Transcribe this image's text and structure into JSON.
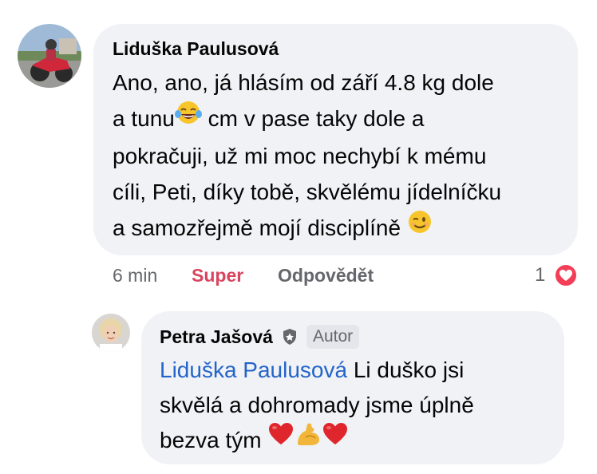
{
  "comment": {
    "author": "Liduška Paulusová",
    "lines": {
      "l1": "Ano, ano, já hlásím od září 4.8 kg dole",
      "l2a": "a tunu",
      "l2b": " cm v pase taky dole a",
      "l3": "pokračuji, už mi moc nechybí k mému",
      "l4": "cíli, Peti, díky tobě, skvělému jídelníčku",
      "l5": "a samozřejmě mojí disciplíně "
    },
    "time": "6 min",
    "reaction_label": "Super",
    "reply_label": "Odpovědět",
    "reaction_count": "1",
    "emoji_icons": [
      "laughing-tears-emoji",
      "winking-face-emoji",
      "heart-reaction-icon"
    ]
  },
  "reply": {
    "author": "Petra Jašová",
    "badge": "Autor",
    "mention": "Liduška Paulusová",
    "lines": {
      "l1": " Li duško jsi",
      "l2": "skvělá a dohromady jsme úplně",
      "l3": "bezva tým "
    },
    "emoji_icons": [
      "red-heart-emoji",
      "flexed-biceps-emoji",
      "red-heart-emoji"
    ]
  },
  "colors": {
    "bubble": "#f0f2f5",
    "mention": "#2464c9",
    "super": "#d9455f",
    "heart": "#f33e58",
    "meta": "#65676b"
  }
}
